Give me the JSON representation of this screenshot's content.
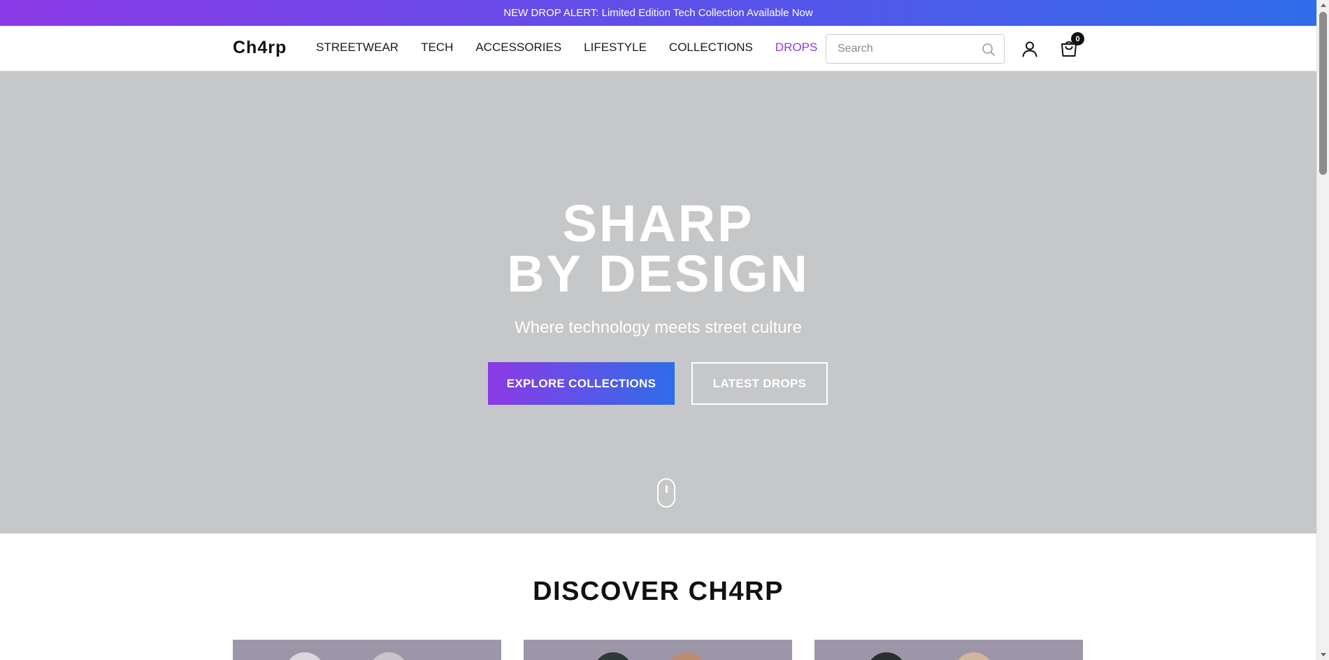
{
  "announcement": {
    "text": "NEW DROP ALERT: Limited Edition Tech Collection Available Now"
  },
  "header": {
    "logo": "Ch4rp",
    "nav": [
      {
        "label": "STREETWEAR"
      },
      {
        "label": "TECH"
      },
      {
        "label": "ACCESSORIES"
      },
      {
        "label": "LIFESTYLE"
      },
      {
        "label": "COLLECTIONS"
      },
      {
        "label": "DROPS",
        "active": true
      }
    ],
    "search": {
      "placeholder": "Search",
      "value": ""
    },
    "account_icon": "user-icon",
    "cart": {
      "icon": "shopping-bag-icon",
      "count": "0"
    }
  },
  "hero": {
    "title_line1": "SHARP",
    "title_line2": "BY DESIGN",
    "subtitle": "Where technology meets street culture",
    "primary_button": "EXPLORE COLLECTIONS",
    "secondary_button": "LATEST DROPS",
    "scroll_icon": "mouse-scroll-icon"
  },
  "discover": {
    "title": "DISCOVER CH4RP"
  },
  "colors": {
    "brand_purple": "#8b3ae6",
    "brand_blue": "#2f6de9",
    "hero_bg": "#c6c7c9",
    "text_dark": "#111111"
  }
}
